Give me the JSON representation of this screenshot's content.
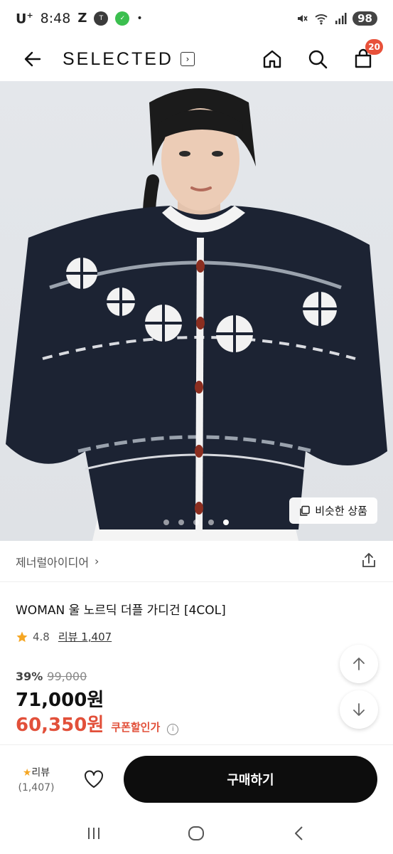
{
  "status_bar": {
    "carrier": "U",
    "carrier_sup": "+",
    "time": "8:48",
    "battery": "98"
  },
  "header": {
    "brand": "SELECTED",
    "cart_count": "20"
  },
  "hero": {
    "similar_label": "비슷한 상품",
    "image_count": 5,
    "active_index": 4
  },
  "store": {
    "name": "제너럴아이디어"
  },
  "product": {
    "title": "WOMAN 울 노르딕 더플 가디건 [4COL]",
    "rating": "4.8",
    "review_label": "리뷰 1,407",
    "discount": "39%",
    "original_price": "99,000",
    "sale_price": "71,000원",
    "coupon_price": "60,350원",
    "coupon_label": "쿠폰할인가"
  },
  "action_bar": {
    "review_label": "리뷰",
    "review_count": "(1,407)",
    "buy_label": "구매하기"
  },
  "colors": {
    "accent": "#e2503a",
    "badge": "#e8513a",
    "buy_button": "#0d0d0d"
  }
}
